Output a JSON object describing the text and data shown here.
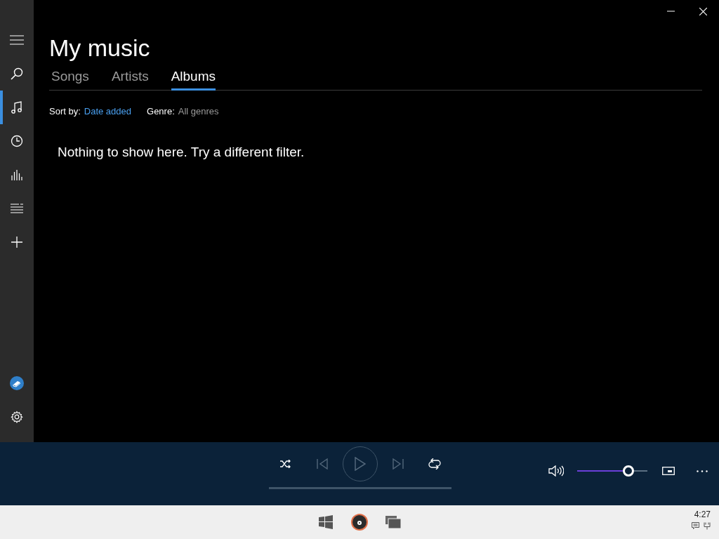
{
  "sidebar": {
    "items": [
      {
        "kind": "menu",
        "selected": false
      },
      {
        "kind": "search",
        "selected": false
      },
      {
        "kind": "music",
        "selected": true
      },
      {
        "kind": "recent",
        "selected": false
      },
      {
        "kind": "now-playing",
        "selected": false
      },
      {
        "kind": "playlists",
        "selected": false
      },
      {
        "kind": "add",
        "selected": false
      }
    ],
    "bottom_items": [
      {
        "kind": "account"
      },
      {
        "kind": "settings"
      }
    ]
  },
  "page": {
    "title": "My music"
  },
  "tabs": [
    {
      "label": "Songs",
      "selected": false
    },
    {
      "label": "Artists",
      "selected": false
    },
    {
      "label": "Albums",
      "selected": true
    }
  ],
  "filters": [
    {
      "label": "Sort by:",
      "value": "Date added",
      "kind": "link"
    },
    {
      "label": "Genre:",
      "value": "All genres",
      "kind": "plain"
    }
  ],
  "empty_message": "Nothing to show here. Try a different filter.",
  "player": {
    "controls": [
      {
        "kind": "shuffle",
        "disabled": false
      },
      {
        "kind": "previous",
        "disabled": true
      },
      {
        "kind": "play",
        "disabled": true
      },
      {
        "kind": "next",
        "disabled": true
      },
      {
        "kind": "repeat",
        "disabled": false
      }
    ],
    "progress": {
      "level": 0
    },
    "volume": {
      "level": 0.73
    }
  },
  "taskbar": {
    "time": "4:27"
  }
}
